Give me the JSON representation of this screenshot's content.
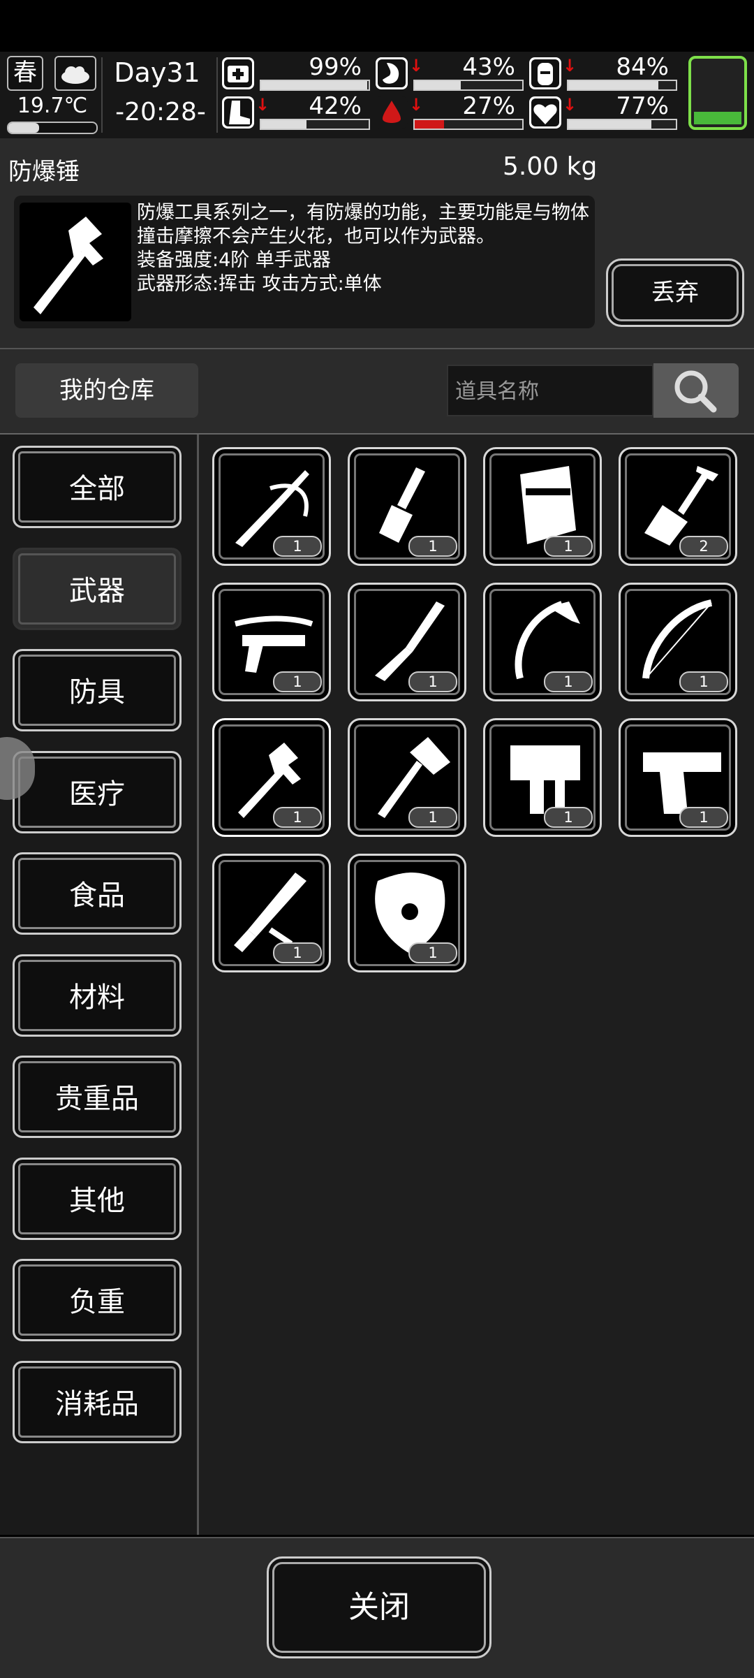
{
  "status": {
    "season": "春",
    "temperature": "19.7℃",
    "temperature_level": 0.35,
    "day": "Day31",
    "time": "-20:28-",
    "stats": [
      {
        "name": "health-icon",
        "pct": "99%",
        "level": 0.99,
        "down": false
      },
      {
        "name": "stomach-icon",
        "pct": "43%",
        "level": 0.43,
        "down": true
      },
      {
        "name": "water-icon",
        "pct": "84%",
        "level": 0.84,
        "down": true
      },
      {
        "name": "boot-icon",
        "pct": "42%",
        "level": 0.42,
        "down": true
      },
      {
        "name": "blood-drop-icon",
        "pct": "27%",
        "level": 0.27,
        "down": true
      },
      {
        "name": "heart-icon",
        "pct": "77%",
        "level": 0.77,
        "down": true
      }
    ],
    "battery_level": 0.18,
    "accent_green": "#49b93a"
  },
  "detail": {
    "name": "防爆锤",
    "weight": "5.00 kg",
    "description": "防爆工具系列之一，有防爆的功能，主要功能是与物体撞击摩擦不会产生火花，也可以作为武器。\n装备强度:4阶 单手武器\n武器形态:挥击 攻击方式:单体",
    "discard_label": "丢弃"
  },
  "search": {
    "warehouse_label": "我的仓库",
    "placeholder": "道具名称"
  },
  "categories": [
    "全部",
    "武器",
    "防具",
    "医疗",
    "食品",
    "材料",
    "贵重品",
    "其他",
    "负重",
    "消耗品"
  ],
  "active_category": "武器",
  "items": [
    {
      "icon": "sword-icon",
      "count": "1"
    },
    {
      "icon": "scraper-icon",
      "count": "1"
    },
    {
      "icon": "riot-shield-icon",
      "count": "1"
    },
    {
      "icon": "shovel-icon",
      "count": "2"
    },
    {
      "icon": "crossbow-icon",
      "count": "1"
    },
    {
      "icon": "knife-icon",
      "count": "1"
    },
    {
      "icon": "ice-axe-icon",
      "count": "1"
    },
    {
      "icon": "bow-icon",
      "count": "1"
    },
    {
      "icon": "hammer-icon",
      "count": "1",
      "selected": true
    },
    {
      "icon": "hatchet-icon",
      "count": "1"
    },
    {
      "icon": "nail-gun-icon",
      "count": "1"
    },
    {
      "icon": "pistol-icon",
      "count": "1"
    },
    {
      "icon": "baton-icon",
      "count": "1"
    },
    {
      "icon": "round-shield-icon",
      "count": "1"
    }
  ],
  "footer": {
    "close_label": "关闭"
  }
}
